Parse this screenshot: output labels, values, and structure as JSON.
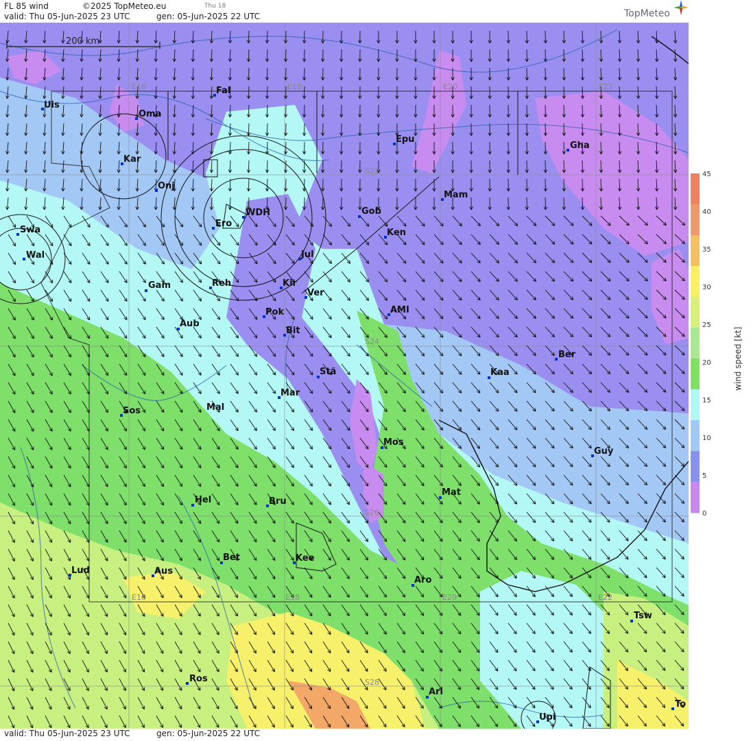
{
  "header": {
    "product": "FL 85 wind",
    "copyright": "©2025 TopMeteo.eu",
    "day_label": "Thu 18",
    "valid": "valid:  Thu  05-Jun-2025  23 UTC",
    "gen": "gen: 05-Jun-2025 22 UTC",
    "logo": "TopMeteo"
  },
  "footer": {
    "valid": "valid:  Thu  05-Jun-2025  23 UTC",
    "gen": "gen: 05-Jun-2025 22 UTC"
  },
  "scale_bar": {
    "label": "200 km"
  },
  "grid_labels": {
    "top": [
      "E16",
      "E18",
      "E20",
      "E22"
    ],
    "bottom": [
      "E16",
      "E18",
      "E20",
      "E22"
    ],
    "lat": [
      "S22",
      "S24",
      "S26",
      "S28"
    ]
  },
  "places": [
    {
      "name": "Uis"
    },
    {
      "name": "Oma"
    },
    {
      "name": "Fal"
    },
    {
      "name": "Epu"
    },
    {
      "name": "Gha"
    },
    {
      "name": "Kar"
    },
    {
      "name": "Onj"
    },
    {
      "name": "Mam"
    },
    {
      "name": "Swa"
    },
    {
      "name": "WDH"
    },
    {
      "name": "Ero"
    },
    {
      "name": "Gob"
    },
    {
      "name": "Ken"
    },
    {
      "name": "Wal"
    },
    {
      "name": "Jul"
    },
    {
      "name": "Gam"
    },
    {
      "name": "Reh"
    },
    {
      "name": "Kir"
    },
    {
      "name": "Ver"
    },
    {
      "name": "Pok"
    },
    {
      "name": "AMI"
    },
    {
      "name": "Aub"
    },
    {
      "name": "Bit"
    },
    {
      "name": "Ber"
    },
    {
      "name": "Stä"
    },
    {
      "name": "Kaa"
    },
    {
      "name": "Mar"
    },
    {
      "name": "Sos"
    },
    {
      "name": "Mal"
    },
    {
      "name": "Mos"
    },
    {
      "name": "Guy"
    },
    {
      "name": "Mat"
    },
    {
      "name": "Hel"
    },
    {
      "name": "Bru"
    },
    {
      "name": "Bet"
    },
    {
      "name": "Kee"
    },
    {
      "name": "Lud"
    },
    {
      "name": "Aus"
    },
    {
      "name": "Aro"
    },
    {
      "name": "Tsw"
    },
    {
      "name": "Ros"
    },
    {
      "name": "Ari"
    },
    {
      "name": "Upi"
    },
    {
      "name": "To"
    }
  ],
  "legend": {
    "title": "wind speed [kt]",
    "ticks": [
      "45",
      "40",
      "35",
      "30",
      "25",
      "20",
      "15",
      "10",
      "5",
      "0"
    ],
    "colors": [
      "#f08060",
      "#f09868",
      "#f5c060",
      "#f8f060",
      "#d8f078",
      "#a8e890",
      "#80e060",
      "#b0f8f8",
      "#a0c8f8",
      "#8890f0",
      "#c888f0"
    ]
  },
  "colors": {
    "purple": "#9a8ff0",
    "violet": "#c88cf0",
    "lightblue": "#a4c8f6",
    "cyan": "#b4f8f6",
    "green": "#7ee06a",
    "yellowgreen": "#c8f080",
    "yellow": "#f6f06a",
    "orange": "#f4a868"
  }
}
